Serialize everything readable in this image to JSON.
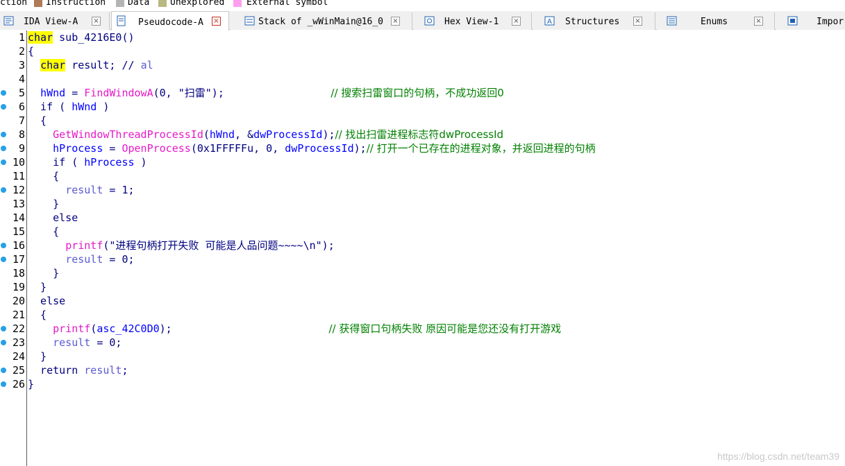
{
  "legend": [
    {
      "label": "ction",
      "color": ""
    },
    {
      "label": "Instruction",
      "color": "#b07a56"
    },
    {
      "label": "Data",
      "color": "#b4b4b4"
    },
    {
      "label": "Unexplored",
      "color": "#b8b880"
    },
    {
      "label": "External symbol",
      "color": "#ff9ef0"
    }
  ],
  "tabs": [
    {
      "label": "IDA View-A",
      "icon": "disassembly-icon",
      "close": "×"
    },
    {
      "label": "Pseudocode-A",
      "icon": "pseudocode-icon",
      "close": "×"
    },
    {
      "label": "Stack of _wWinMain@16_0",
      "icon": "stack-icon",
      "close": "×"
    },
    {
      "label": "Hex View-1",
      "icon": "hex-icon",
      "close": "×"
    },
    {
      "label": "Structures",
      "icon": "structures-icon",
      "close": "×"
    },
    {
      "label": "Enums",
      "icon": "enums-icon",
      "close": "×"
    },
    {
      "label": "Impor",
      "icon": "imports-icon",
      "close": ""
    }
  ],
  "lines": [
    {
      "n": "1",
      "dot": false,
      "tokens": [
        [
          "kw-hl",
          "char"
        ],
        [
          "plain",
          " sub_4216E0()"
        ]
      ]
    },
    {
      "n": "2",
      "dot": false,
      "tokens": [
        [
          "plain",
          "{"
        ]
      ]
    },
    {
      "n": "3",
      "dot": false,
      "tokens": [
        [
          "plain",
          "  "
        ],
        [
          "kw-hl",
          "char"
        ],
        [
          "plain",
          " result; "
        ],
        [
          "kw",
          "// "
        ],
        [
          "lvar",
          "al"
        ]
      ]
    },
    {
      "n": "4",
      "dot": false,
      "tokens": []
    },
    {
      "n": "5",
      "dot": true,
      "tokens": [
        [
          "plain",
          "  "
        ],
        [
          "var",
          "hWnd"
        ],
        [
          "plain",
          " = "
        ],
        [
          "fn",
          "FindWindowA"
        ],
        [
          "plain",
          "(0, \"扫雷\");                 "
        ],
        [
          "cmt",
          "// 搜索扫雷窗口的句柄，不成功返回0"
        ]
      ]
    },
    {
      "n": "6",
      "dot": true,
      "tokens": [
        [
          "plain",
          "  if ( "
        ],
        [
          "var",
          "hWnd"
        ],
        [
          "plain",
          " )"
        ]
      ]
    },
    {
      "n": "7",
      "dot": false,
      "tokens": [
        [
          "plain",
          "  {"
        ]
      ]
    },
    {
      "n": "8",
      "dot": true,
      "tokens": [
        [
          "plain",
          "    "
        ],
        [
          "fn",
          "GetWindowThreadProcessId"
        ],
        [
          "plain",
          "("
        ],
        [
          "var",
          "hWnd"
        ],
        [
          "plain",
          ", &"
        ],
        [
          "var",
          "dwProcessId"
        ],
        [
          "plain",
          ");"
        ],
        [
          "cmt",
          "// 找出扫雷进程标志符dwProcessId"
        ]
      ]
    },
    {
      "n": "9",
      "dot": true,
      "tokens": [
        [
          "plain",
          "    "
        ],
        [
          "var",
          "hProcess"
        ],
        [
          "plain",
          " = "
        ],
        [
          "fn",
          "OpenProcess"
        ],
        [
          "plain",
          "(0x1FFFFFu, 0, "
        ],
        [
          "var",
          "dwProcessId"
        ],
        [
          "plain",
          ");"
        ],
        [
          "cmt",
          "// 打开一个已存在的进程对象，并返回进程的句柄"
        ]
      ]
    },
    {
      "n": "10",
      "dot": true,
      "tokens": [
        [
          "plain",
          "    if ( "
        ],
        [
          "var",
          "hProcess"
        ],
        [
          "plain",
          " )"
        ]
      ]
    },
    {
      "n": "11",
      "dot": false,
      "tokens": [
        [
          "plain",
          "    {"
        ]
      ]
    },
    {
      "n": "12",
      "dot": true,
      "tokens": [
        [
          "plain",
          "      "
        ],
        [
          "lvar",
          "result"
        ],
        [
          "plain",
          " = 1;"
        ]
      ]
    },
    {
      "n": "13",
      "dot": false,
      "tokens": [
        [
          "plain",
          "    }"
        ]
      ]
    },
    {
      "n": "14",
      "dot": false,
      "tokens": [
        [
          "plain",
          "    else"
        ]
      ]
    },
    {
      "n": "15",
      "dot": false,
      "tokens": [
        [
          "plain",
          "    {"
        ]
      ]
    },
    {
      "n": "16",
      "dot": true,
      "tokens": [
        [
          "plain",
          "      "
        ],
        [
          "fn",
          "printf"
        ],
        [
          "plain",
          "(\"进程句柄打开失败 可能是人品问题~~~~\\n\");"
        ]
      ]
    },
    {
      "n": "17",
      "dot": true,
      "tokens": [
        [
          "plain",
          "      "
        ],
        [
          "lvar",
          "result"
        ],
        [
          "plain",
          " = 0;"
        ]
      ]
    },
    {
      "n": "18",
      "dot": false,
      "tokens": [
        [
          "plain",
          "    }"
        ]
      ]
    },
    {
      "n": "19",
      "dot": false,
      "tokens": [
        [
          "plain",
          "  }"
        ]
      ]
    },
    {
      "n": "20",
      "dot": false,
      "tokens": [
        [
          "plain",
          "  else"
        ]
      ]
    },
    {
      "n": "21",
      "dot": false,
      "tokens": [
        [
          "plain",
          "  {"
        ]
      ]
    },
    {
      "n": "22",
      "dot": true,
      "tokens": [
        [
          "plain",
          "    "
        ],
        [
          "fn",
          "printf"
        ],
        [
          "plain",
          "("
        ],
        [
          "var",
          "asc_42C0D0"
        ],
        [
          "plain",
          ");                         "
        ],
        [
          "cmt",
          "// 获得窗口句柄失败 原因可能是您还没有打开游戏"
        ]
      ]
    },
    {
      "n": "23",
      "dot": true,
      "tokens": [
        [
          "plain",
          "    "
        ],
        [
          "lvar",
          "result"
        ],
        [
          "plain",
          " = 0;"
        ]
      ]
    },
    {
      "n": "24",
      "dot": false,
      "tokens": [
        [
          "plain",
          "  }"
        ]
      ]
    },
    {
      "n": "25",
      "dot": true,
      "tokens": [
        [
          "plain",
          "  return "
        ],
        [
          "lvar",
          "result"
        ],
        [
          "plain",
          ";"
        ]
      ]
    },
    {
      "n": "26",
      "dot": true,
      "tokens": [
        [
          "plain",
          "}"
        ]
      ]
    }
  ],
  "watermark": "https://blog.csdn.net/team39"
}
